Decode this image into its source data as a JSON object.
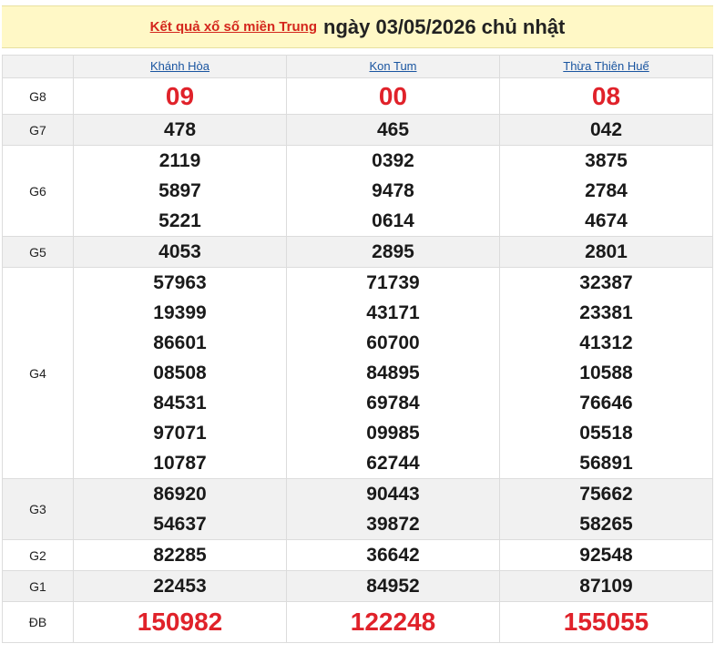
{
  "header": {
    "link_text": "Kết quả xổ số miền Trung",
    "date_text": "ngày 03/05/2026 chủ nhật"
  },
  "table": {
    "provinces": [
      "Khánh Hòa",
      "Kon Tum",
      "Thừa Thiên Huế"
    ],
    "rows": [
      {
        "label": "G8",
        "values": [
          [
            "09"
          ],
          [
            "00"
          ],
          [
            "08"
          ]
        ]
      },
      {
        "label": "G7",
        "values": [
          [
            "478"
          ],
          [
            "465"
          ],
          [
            "042"
          ]
        ]
      },
      {
        "label": "G6",
        "values": [
          [
            "2119",
            "5897",
            "5221"
          ],
          [
            "0392",
            "9478",
            "0614"
          ],
          [
            "3875",
            "2784",
            "4674"
          ]
        ]
      },
      {
        "label": "G5",
        "values": [
          [
            "4053"
          ],
          [
            "2895"
          ],
          [
            "2801"
          ]
        ]
      },
      {
        "label": "G4",
        "values": [
          [
            "57963",
            "19399",
            "86601",
            "08508",
            "84531",
            "97071",
            "10787"
          ],
          [
            "71739",
            "43171",
            "60700",
            "84895",
            "69784",
            "09985",
            "62744"
          ],
          [
            "32387",
            "23381",
            "41312",
            "10588",
            "76646",
            "05518",
            "56891"
          ]
        ]
      },
      {
        "label": "G3",
        "values": [
          [
            "86920",
            "54637"
          ],
          [
            "90443",
            "39872"
          ],
          [
            "75662",
            "58265"
          ]
        ]
      },
      {
        "label": "G2",
        "values": [
          [
            "82285"
          ],
          [
            "36642"
          ],
          [
            "92548"
          ]
        ]
      },
      {
        "label": "G1",
        "values": [
          [
            "22453"
          ],
          [
            "84952"
          ],
          [
            "87109"
          ]
        ]
      },
      {
        "label": "ĐB",
        "values": [
          [
            "150982"
          ],
          [
            "122248"
          ],
          [
            "155055"
          ]
        ]
      }
    ]
  },
  "colors": {
    "header_bg": "#fff8c6",
    "accent_red": "#e0222a",
    "link_blue": "#1a55a0"
  }
}
